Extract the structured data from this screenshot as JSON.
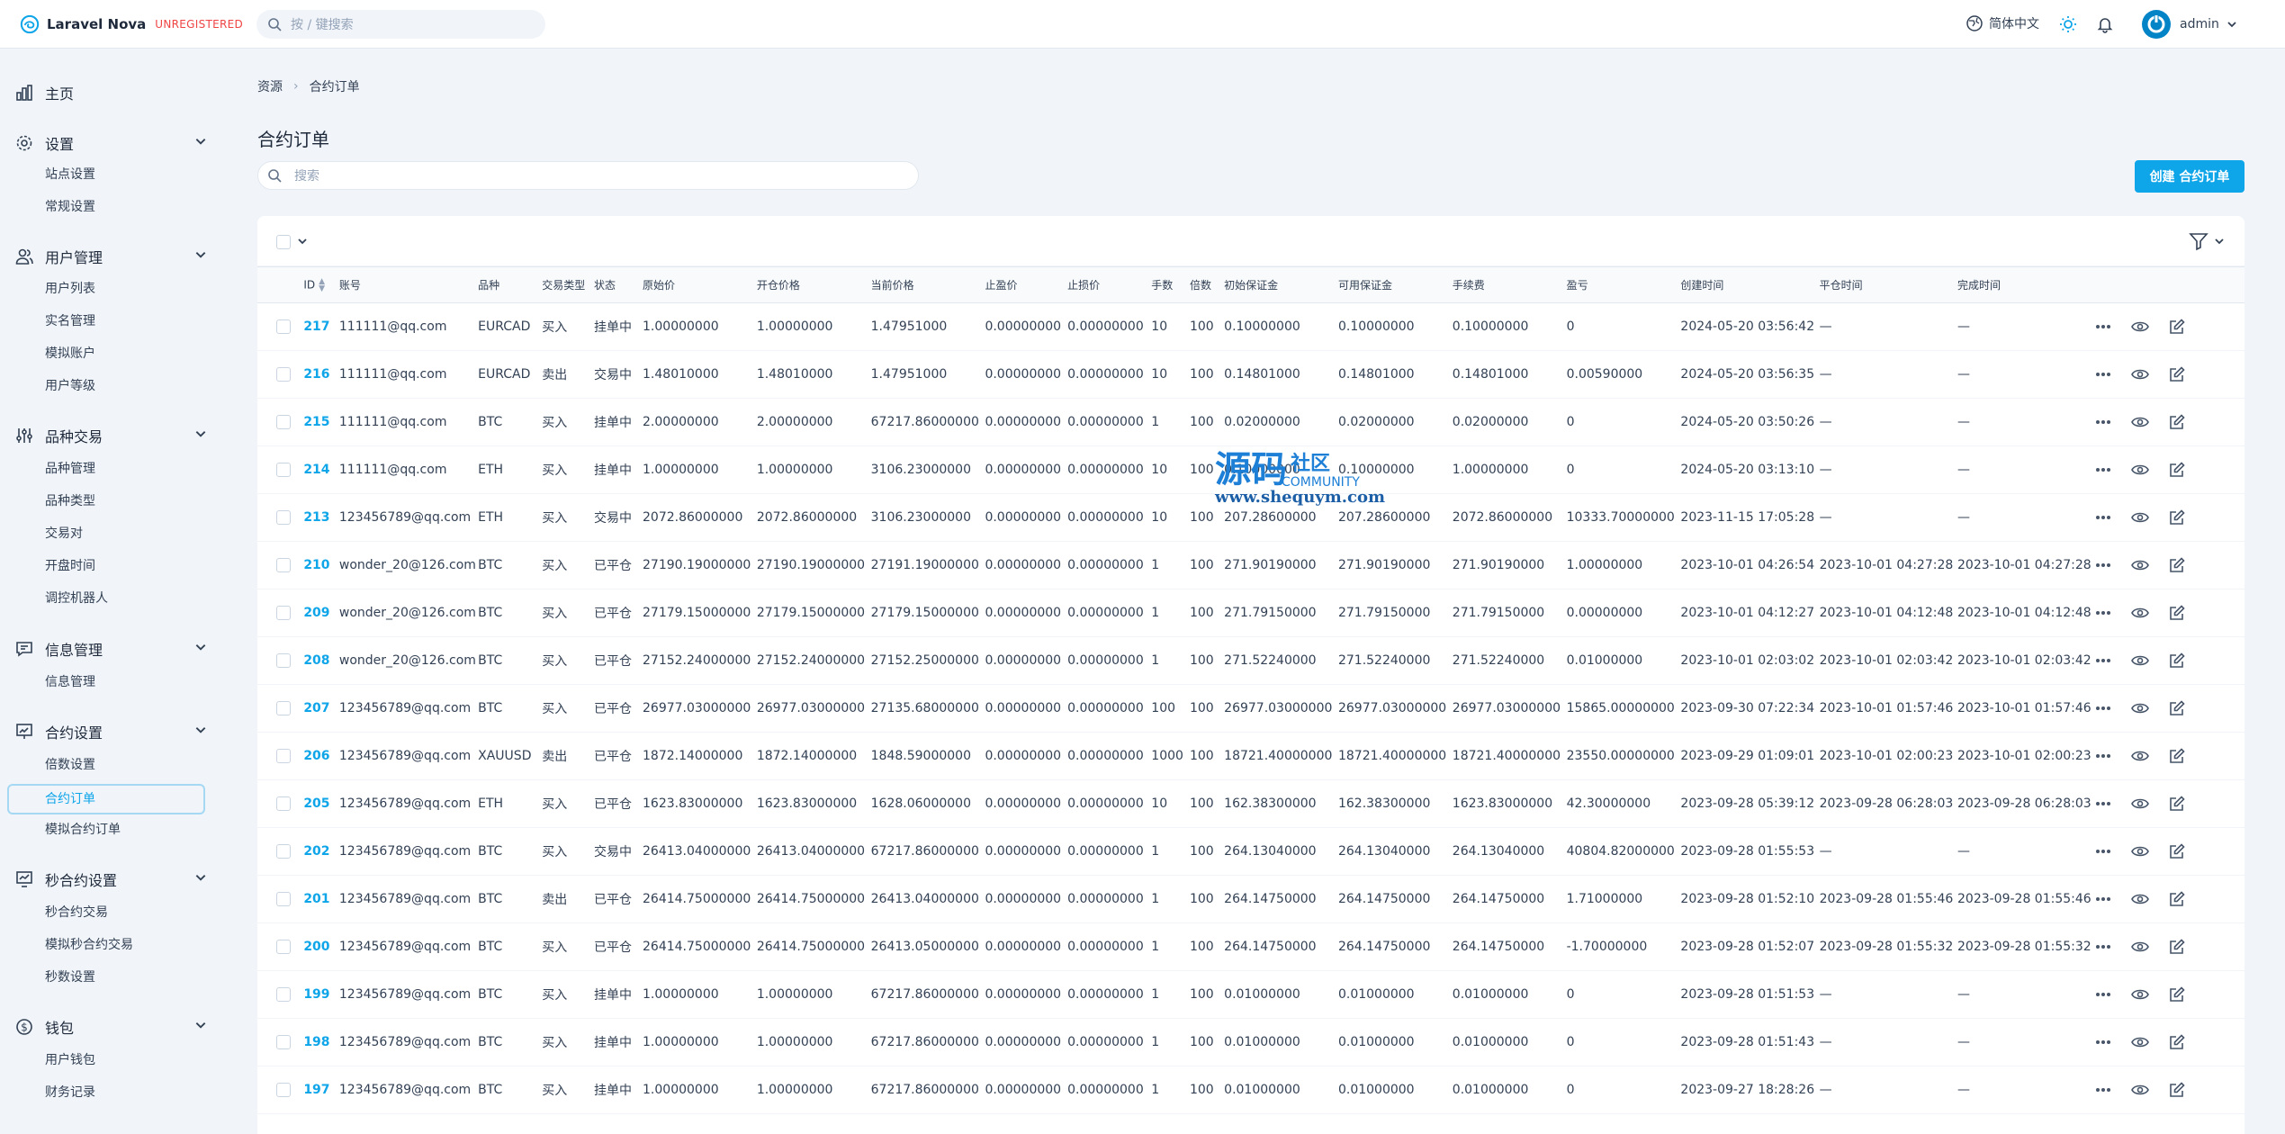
{
  "app": {
    "name": "Laravel Nova",
    "unregistered": "UNREGISTERED"
  },
  "global_search": {
    "placeholder": "按 / 键搜索"
  },
  "header": {
    "language": "简体中文",
    "user": "admin"
  },
  "sidebar": {
    "groups": [
      {
        "label": "主页",
        "icon": "chart-bar-icon",
        "items": []
      },
      {
        "label": "设置",
        "icon": "gear-icon",
        "items": [
          "站点设置",
          "常规设置"
        ]
      },
      {
        "label": "用户管理",
        "icon": "users-icon",
        "items": [
          "用户列表",
          "实名管理",
          "模拟账户",
          "用户等级"
        ]
      },
      {
        "label": "品种交易",
        "icon": "sliders-icon",
        "items": [
          "品种管理",
          "品种类型",
          "交易对",
          "开盘时间",
          "调控机器人"
        ]
      },
      {
        "label": "信息管理",
        "icon": "chat-icon",
        "items": [
          "信息管理"
        ]
      },
      {
        "label": "合约设置",
        "icon": "presentation-chart-icon",
        "items": [
          "倍数设置",
          "合约订单",
          "模拟合约订单"
        ]
      },
      {
        "label": "秒合约设置",
        "icon": "trend-chart-icon",
        "items": [
          "秒合约交易",
          "模拟秒合约交易",
          "秒数设置"
        ]
      },
      {
        "label": "钱包",
        "icon": "dollar-icon",
        "items": [
          "用户钱包",
          "财务记录"
        ]
      }
    ],
    "active_item": "合约订单"
  },
  "breadcrumb": {
    "root": "资源",
    "current": "合约订单"
  },
  "page_title": "合约订单",
  "resource_search": {
    "placeholder": "搜索"
  },
  "create_button": "创建 合约订单",
  "table": {
    "columns": [
      "ID",
      "账号",
      "品种",
      "交易类型",
      "状态",
      "原始价",
      "开仓价格",
      "当前价格",
      "止盈价",
      "止损价",
      "手数",
      "倍数",
      "初始保证金",
      "可用保证金",
      "手续费",
      "盈亏",
      "创建时间",
      "平仓时间",
      "完成时间"
    ],
    "rows": [
      [
        "217",
        "111111@qq.com",
        "EURCAD",
        "买入",
        "挂单中",
        "1.00000000",
        "1.00000000",
        "1.47951000",
        "0.00000000",
        "0.00000000",
        "10",
        "100",
        "0.10000000",
        "0.10000000",
        "0.10000000",
        "0",
        "2024-05-20 03:56:42",
        "—",
        "—"
      ],
      [
        "216",
        "111111@qq.com",
        "EURCAD",
        "卖出",
        "交易中",
        "1.48010000",
        "1.48010000",
        "1.47951000",
        "0.00000000",
        "0.00000000",
        "10",
        "100",
        "0.14801000",
        "0.14801000",
        "0.14801000",
        "0.00590000",
        "2024-05-20 03:56:35",
        "—",
        "—"
      ],
      [
        "215",
        "111111@qq.com",
        "BTC",
        "买入",
        "挂单中",
        "2.00000000",
        "2.00000000",
        "67217.86000000",
        "0.00000000",
        "0.00000000",
        "1",
        "100",
        "0.02000000",
        "0.02000000",
        "0.02000000",
        "0",
        "2024-05-20 03:50:26",
        "—",
        "—"
      ],
      [
        "214",
        "111111@qq.com",
        "ETH",
        "买入",
        "挂单中",
        "1.00000000",
        "1.00000000",
        "3106.23000000",
        "0.00000000",
        "0.00000000",
        "10",
        "100",
        "0.10000000",
        "0.10000000",
        "1.00000000",
        "0",
        "2024-05-20 03:13:10",
        "—",
        "—"
      ],
      [
        "213",
        "123456789@qq.com",
        "ETH",
        "买入",
        "交易中",
        "2072.86000000",
        "2072.86000000",
        "3106.23000000",
        "0.00000000",
        "0.00000000",
        "10",
        "100",
        "207.28600000",
        "207.28600000",
        "2072.86000000",
        "10333.70000000",
        "2023-11-15 17:05:28",
        "—",
        "—"
      ],
      [
        "210",
        "wonder_20@126.com",
        "BTC",
        "买入",
        "已平仓",
        "27190.19000000",
        "27190.19000000",
        "27191.19000000",
        "0.00000000",
        "0.00000000",
        "1",
        "100",
        "271.90190000",
        "271.90190000",
        "271.90190000",
        "1.00000000",
        "2023-10-01 04:26:54",
        "2023-10-01 04:27:28",
        "2023-10-01 04:27:28"
      ],
      [
        "209",
        "wonder_20@126.com",
        "BTC",
        "买入",
        "已平仓",
        "27179.15000000",
        "27179.15000000",
        "27179.15000000",
        "0.00000000",
        "0.00000000",
        "1",
        "100",
        "271.79150000",
        "271.79150000",
        "271.79150000",
        "0.00000000",
        "2023-10-01 04:12:27",
        "2023-10-01 04:12:48",
        "2023-10-01 04:12:48"
      ],
      [
        "208",
        "wonder_20@126.com",
        "BTC",
        "买入",
        "已平仓",
        "27152.24000000",
        "27152.24000000",
        "27152.25000000",
        "0.00000000",
        "0.00000000",
        "1",
        "100",
        "271.52240000",
        "271.52240000",
        "271.52240000",
        "0.01000000",
        "2023-10-01 02:03:02",
        "2023-10-01 02:03:42",
        "2023-10-01 02:03:42"
      ],
      [
        "207",
        "123456789@qq.com",
        "BTC",
        "买入",
        "已平仓",
        "26977.03000000",
        "26977.03000000",
        "27135.68000000",
        "0.00000000",
        "0.00000000",
        "100",
        "100",
        "26977.03000000",
        "26977.03000000",
        "26977.03000000",
        "15865.00000000",
        "2023-09-30 07:22:34",
        "2023-10-01 01:57:46",
        "2023-10-01 01:57:46"
      ],
      [
        "206",
        "123456789@qq.com",
        "XAUUSD",
        "卖出",
        "已平仓",
        "1872.14000000",
        "1872.14000000",
        "1848.59000000",
        "0.00000000",
        "0.00000000",
        "1000",
        "100",
        "18721.40000000",
        "18721.40000000",
        "18721.40000000",
        "23550.00000000",
        "2023-09-29 01:09:01",
        "2023-10-01 02:00:23",
        "2023-10-01 02:00:23"
      ],
      [
        "205",
        "123456789@qq.com",
        "ETH",
        "买入",
        "已平仓",
        "1623.83000000",
        "1623.83000000",
        "1628.06000000",
        "0.00000000",
        "0.00000000",
        "10",
        "100",
        "162.38300000",
        "162.38300000",
        "1623.83000000",
        "42.30000000",
        "2023-09-28 05:39:12",
        "2023-09-28 06:28:03",
        "2023-09-28 06:28:03"
      ],
      [
        "202",
        "123456789@qq.com",
        "BTC",
        "买入",
        "交易中",
        "26413.04000000",
        "26413.04000000",
        "67217.86000000",
        "0.00000000",
        "0.00000000",
        "1",
        "100",
        "264.13040000",
        "264.13040000",
        "264.13040000",
        "40804.82000000",
        "2023-09-28 01:55:53",
        "—",
        "—"
      ],
      [
        "201",
        "123456789@qq.com",
        "BTC",
        "卖出",
        "已平仓",
        "26414.75000000",
        "26414.75000000",
        "26413.04000000",
        "0.00000000",
        "0.00000000",
        "1",
        "100",
        "264.14750000",
        "264.14750000",
        "264.14750000",
        "1.71000000",
        "2023-09-28 01:52:10",
        "2023-09-28 01:55:46",
        "2023-09-28 01:55:46"
      ],
      [
        "200",
        "123456789@qq.com",
        "BTC",
        "买入",
        "已平仓",
        "26414.75000000",
        "26414.75000000",
        "26413.05000000",
        "0.00000000",
        "0.00000000",
        "1",
        "100",
        "264.14750000",
        "264.14750000",
        "264.14750000",
        "-1.70000000",
        "2023-09-28 01:52:07",
        "2023-09-28 01:55:32",
        "2023-09-28 01:55:32"
      ],
      [
        "199",
        "123456789@qq.com",
        "BTC",
        "买入",
        "挂单中",
        "1.00000000",
        "1.00000000",
        "67217.86000000",
        "0.00000000",
        "0.00000000",
        "1",
        "100",
        "0.01000000",
        "0.01000000",
        "0.01000000",
        "0",
        "2023-09-28 01:51:53",
        "—",
        "—"
      ],
      [
        "198",
        "123456789@qq.com",
        "BTC",
        "买入",
        "挂单中",
        "1.00000000",
        "1.00000000",
        "67217.86000000",
        "0.00000000",
        "0.00000000",
        "1",
        "100",
        "0.01000000",
        "0.01000000",
        "0.01000000",
        "0",
        "2023-09-28 01:51:43",
        "—",
        "—"
      ],
      [
        "197",
        "123456789@qq.com",
        "BTC",
        "买入",
        "挂单中",
        "1.00000000",
        "1.00000000",
        "67217.86000000",
        "0.00000000",
        "0.00000000",
        "1",
        "100",
        "0.01000000",
        "0.01000000",
        "0.01000000",
        "0",
        "2023-09-27 18:28:26",
        "—",
        "—"
      ]
    ]
  },
  "watermark": {
    "big": "源码",
    "small": "社区",
    "en": "COMMUNITY",
    "url": "www.shequym.com"
  },
  "colors": {
    "accent": "#0ea5e9",
    "unregistered": "#ef4444",
    "background": "#f1f5f9"
  }
}
